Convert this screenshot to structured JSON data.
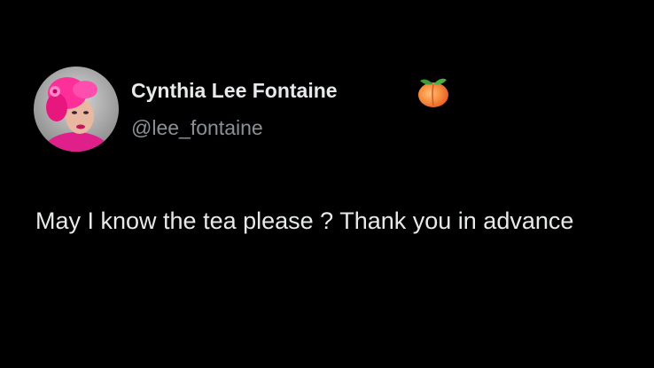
{
  "tweet": {
    "author": {
      "name": "Cynthia Lee Fontaine",
      "handle": "@lee_fontaine",
      "avatar_icon": "profile-photo",
      "badge_emoji_icon": "peach-icon"
    },
    "text": "May I know the tea please ? Thank you in advance"
  },
  "colors": {
    "background": "#000000",
    "name_text": "#e7e9ea",
    "handle_text": "#8b9096",
    "body_text": "#e7e9ea"
  }
}
